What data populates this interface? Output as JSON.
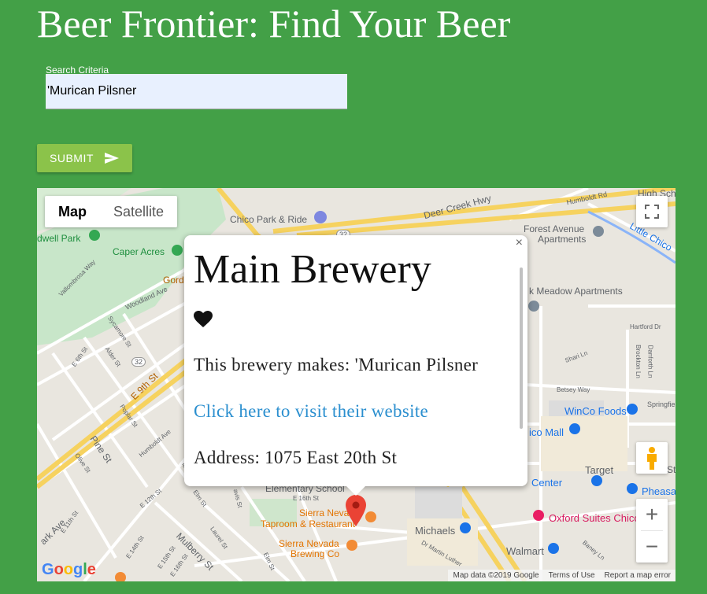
{
  "header": {
    "title": "Beer Frontier: Find Your Beer"
  },
  "search": {
    "label": "Search Criteria",
    "value": "'Murican Pilsner"
  },
  "submit": {
    "label": "SUBMIT"
  },
  "map": {
    "maptype": {
      "map": "Map",
      "satellite": "Satellite"
    },
    "labels": {
      "deer_creek": "Deer Creek Hwy",
      "chico_park": "Chico Park & Ride",
      "humboldt_rd": "Humboldt Rd",
      "high_sch": "High Sch",
      "forest_avenue": "Forest Avenue",
      "apartments": "Apartments",
      "little_chico": "Little Chico",
      "bidwell_park": "dwell Park",
      "caper_acres": "Caper Acres",
      "gord": "Gord",
      "vallombrosa": "Vallombrosa Way",
      "woodland": "Woodland Ave",
      "meadow": "k Meadow Apartments",
      "hartford": "Hartford Dr",
      "sycamore": "Sycamore St",
      "e6th": "E 6th St",
      "alder": "Alder St",
      "e9th": "E 9th St",
      "shari": "Shari Ln",
      "brockton": "Brockton Ln",
      "danforth": "Danforth Ln",
      "betsey": "Betsey Way",
      "winco": "WinCo Foods",
      "springfield": "Springfie",
      "chico_mall": "ico Mall",
      "poplar": "Poplar St",
      "pine": "Pine St",
      "olive": "Olive St",
      "humboldt_ave": "Humboldt Ave",
      "target": "Target",
      "center": "Center",
      "pheasant": "Pheasa",
      "elementary": "Elementary School",
      "e16th": "E 16th St",
      "sierra_nevada_taproom1": "Sierra Neva",
      "sierra_nevada_taproom2": "Taproom & Restaurant",
      "oxford": "Oxford Suites Chico",
      "michaels": "Michaels",
      "sierra_brewing1": "Sierra Nevada",
      "sierra_brewing2": "Brewing Co",
      "walmart": "Walmart",
      "ark_ave": "ark Ave",
      "mulberry": "Mulberry St",
      "dr_martin": "Dr Martin Luther",
      "e11th": "E 11th St",
      "e12th": "E 12th St",
      "e14th": "E 14th St",
      "e15th": "E 15th St",
      "e16th_b": "E 16th St",
      "laurel": "Laurel St",
      "elm": "Elm St",
      "elm2": "Elm St",
      "davis": "avis St",
      "mill": "Mill St",
      "baney": "Baney Ln",
      "r32a": "32",
      "r32b": "32",
      "st_right": "St"
    },
    "popup": {
      "title": "Main Brewery",
      "makes": "This brewery makes: 'Murican Pilsner",
      "link": "Click here to visit their website",
      "address": "Address: 1075 East 20th St",
      "close": "×"
    },
    "zoom": {
      "in": "+",
      "out": "−"
    },
    "footer": {
      "data": "Map data ©2019 Google",
      "terms": "Terms of Use",
      "report": "Report a map error"
    },
    "google": "Google",
    "icons": {
      "pin": "map-marker-icon",
      "heart": "heart-icon",
      "fullscreen": "fullscreen-icon",
      "pegman": "pegman-icon",
      "send": "send-icon"
    }
  }
}
